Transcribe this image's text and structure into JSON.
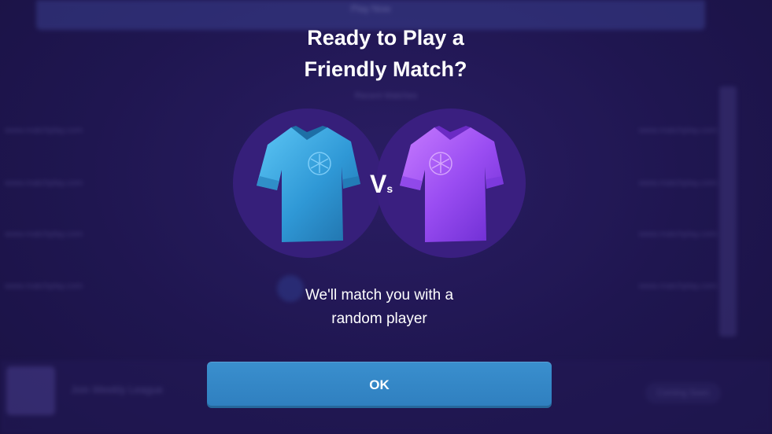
{
  "background": {
    "topbar_text": "Play Now",
    "subtitle": "Recent Matches",
    "rows_left": [
      "www.matchplay.com",
      "www.matchplay.com",
      "www.matchplay.com",
      "www.matchplay.com"
    ],
    "rows_right": [
      "www.matchplay.com",
      "www.matchplay.com",
      "www.matchplay.com",
      "www.matchplay.com"
    ],
    "league_label": "Join Weekly League",
    "pill_label": "Coming Soon"
  },
  "dialog": {
    "title_line1": "Ready to Play a",
    "title_line2": "Friendly Match?",
    "vs_big": "V",
    "vs_small": "s",
    "message_line1": "We'll match you with a",
    "message_line2": "random player",
    "ok_label": "OK"
  },
  "icons": {
    "left": "jersey-blue-icon",
    "right": "jersey-purple-icon"
  },
  "colors": {
    "background": "#1f1650",
    "circle": "#361f7a",
    "jersey_left": "#3aa7e0",
    "jersey_right": "#9b4cf0",
    "button": "#3586c6",
    "text": "#ffffff"
  }
}
